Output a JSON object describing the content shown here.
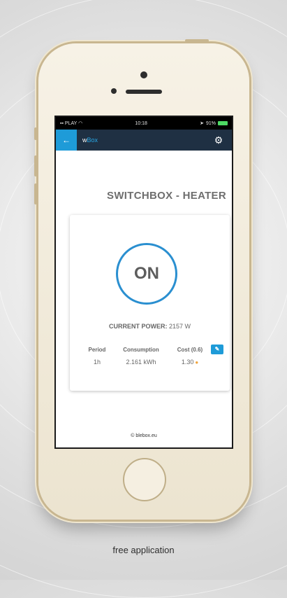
{
  "status_bar": {
    "carrier": "PLAY",
    "time": "10:18",
    "battery": "91%"
  },
  "app_bar": {
    "title_prefix": "w",
    "title_accent": "Box",
    "back_icon": "arrow-left-icon",
    "settings_icon": "gear-icon"
  },
  "device": {
    "title": "SWITCHBOX - HEATER",
    "state_label": "ON",
    "current_power_label": "CURRENT POWER:",
    "current_power_value": "2157 W"
  },
  "stats": {
    "headers": [
      "Period",
      "Consumption",
      "Cost (0.6)"
    ],
    "values": [
      "1h",
      "2.161 kWh",
      "1.30"
    ]
  },
  "footer": {
    "link": "© blebox.eu"
  },
  "caption": "free application",
  "colors": {
    "accent_blue": "#1e9bd8",
    "app_bar_bg": "#1f3043",
    "ring_blue": "#2a8fd0"
  }
}
